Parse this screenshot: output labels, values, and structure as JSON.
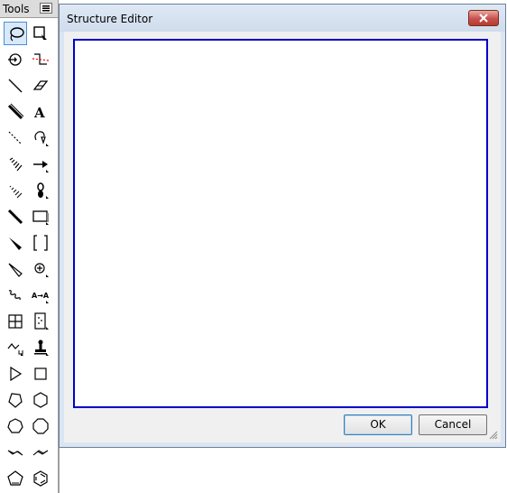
{
  "tools": {
    "title": "Tools",
    "items": [
      {
        "id": "lasso",
        "icon": "lasso-icon"
      },
      {
        "id": "marquee",
        "icon": "marquee-select-icon"
      },
      {
        "id": "rotate",
        "icon": "rotate-icon"
      },
      {
        "id": "chain",
        "icon": "chain-icon"
      },
      {
        "id": "solid-bond",
        "icon": "solid-bond-icon"
      },
      {
        "id": "eraser",
        "icon": "eraser-icon"
      },
      {
        "id": "bold-bond",
        "icon": "bold-bond-icon"
      },
      {
        "id": "text",
        "icon": "text-icon",
        "glyph": "A"
      },
      {
        "id": "dashed-bond",
        "icon": "dashed-bond-icon"
      },
      {
        "id": "pen",
        "icon": "pen-icon"
      },
      {
        "id": "hashed-bond",
        "icon": "hashed-bond-icon"
      },
      {
        "id": "arrow",
        "icon": "arrow-icon"
      },
      {
        "id": "hashed-wedge",
        "icon": "hashed-wedge-icon"
      },
      {
        "id": "orbital",
        "icon": "orbital-icon"
      },
      {
        "id": "bold-line",
        "icon": "bold-line-icon"
      },
      {
        "id": "frame",
        "icon": "frame-icon"
      },
      {
        "id": "wedge",
        "icon": "wedge-bond-icon"
      },
      {
        "id": "bracket",
        "icon": "bracket-icon"
      },
      {
        "id": "hollow-wedge",
        "icon": "hollow-wedge-icon"
      },
      {
        "id": "charge",
        "icon": "charge-icon"
      },
      {
        "id": "wavy-bond",
        "icon": "wavy-bond-icon"
      },
      {
        "id": "text-mapping",
        "icon": "atom-mapping-icon",
        "glyph": "A→A"
      },
      {
        "id": "table",
        "icon": "table-icon"
      },
      {
        "id": "tlc",
        "icon": "tlc-plate-icon"
      },
      {
        "id": "query",
        "icon": "query-bond-icon"
      },
      {
        "id": "stamp",
        "icon": "stamp-icon"
      },
      {
        "id": "triangle",
        "icon": "triangle-icon"
      },
      {
        "id": "square",
        "icon": "square-icon"
      },
      {
        "id": "pentagon",
        "icon": "pentagon-icon"
      },
      {
        "id": "hexagon",
        "icon": "hexagon-icon"
      },
      {
        "id": "heptagon",
        "icon": "heptagon-icon"
      },
      {
        "id": "octagon",
        "icon": "octagon-icon"
      },
      {
        "id": "cyclohexane-chair-1",
        "icon": "chair-left-icon"
      },
      {
        "id": "cyclohexane-chair-2",
        "icon": "chair-right-icon"
      },
      {
        "id": "cyclopentadiene",
        "icon": "cyclopentadiene-icon"
      },
      {
        "id": "benzene",
        "icon": "benzene-icon"
      }
    ]
  },
  "dialog": {
    "title": "Structure Editor",
    "ok_label": "OK",
    "cancel_label": "Cancel"
  },
  "colors": {
    "canvas_border": "#0000c8",
    "selected_tool": "#d7e9fb",
    "close_button": "#c75050"
  }
}
